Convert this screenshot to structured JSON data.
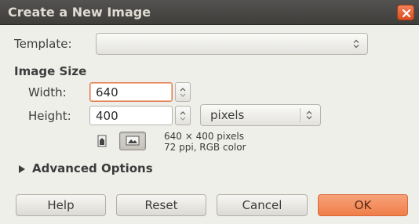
{
  "window": {
    "title": "Create a New Image",
    "close_icon": "close-x-icon"
  },
  "template": {
    "label": "Template:",
    "value": ""
  },
  "image_size": {
    "heading": "Image Size",
    "width_label": "Width:",
    "width_value": "640",
    "height_label": "Height:",
    "height_value": "400",
    "unit": "pixels",
    "portrait_icon": "portrait-orientation-icon",
    "landscape_icon": "landscape-orientation-icon",
    "info_line1": "640 × 400 pixels",
    "info_line2": "72 ppi, RGB color"
  },
  "advanced": {
    "label": "Advanced Options",
    "expanded": false
  },
  "buttons": {
    "help": "Help",
    "reset": "Reset",
    "cancel": "Cancel",
    "ok": "OK"
  },
  "colors": {
    "accent": "#ef7e49",
    "focus_border": "#e2784b",
    "titlebar": "#3f3e3b",
    "close_button": "#dc4e1f"
  }
}
